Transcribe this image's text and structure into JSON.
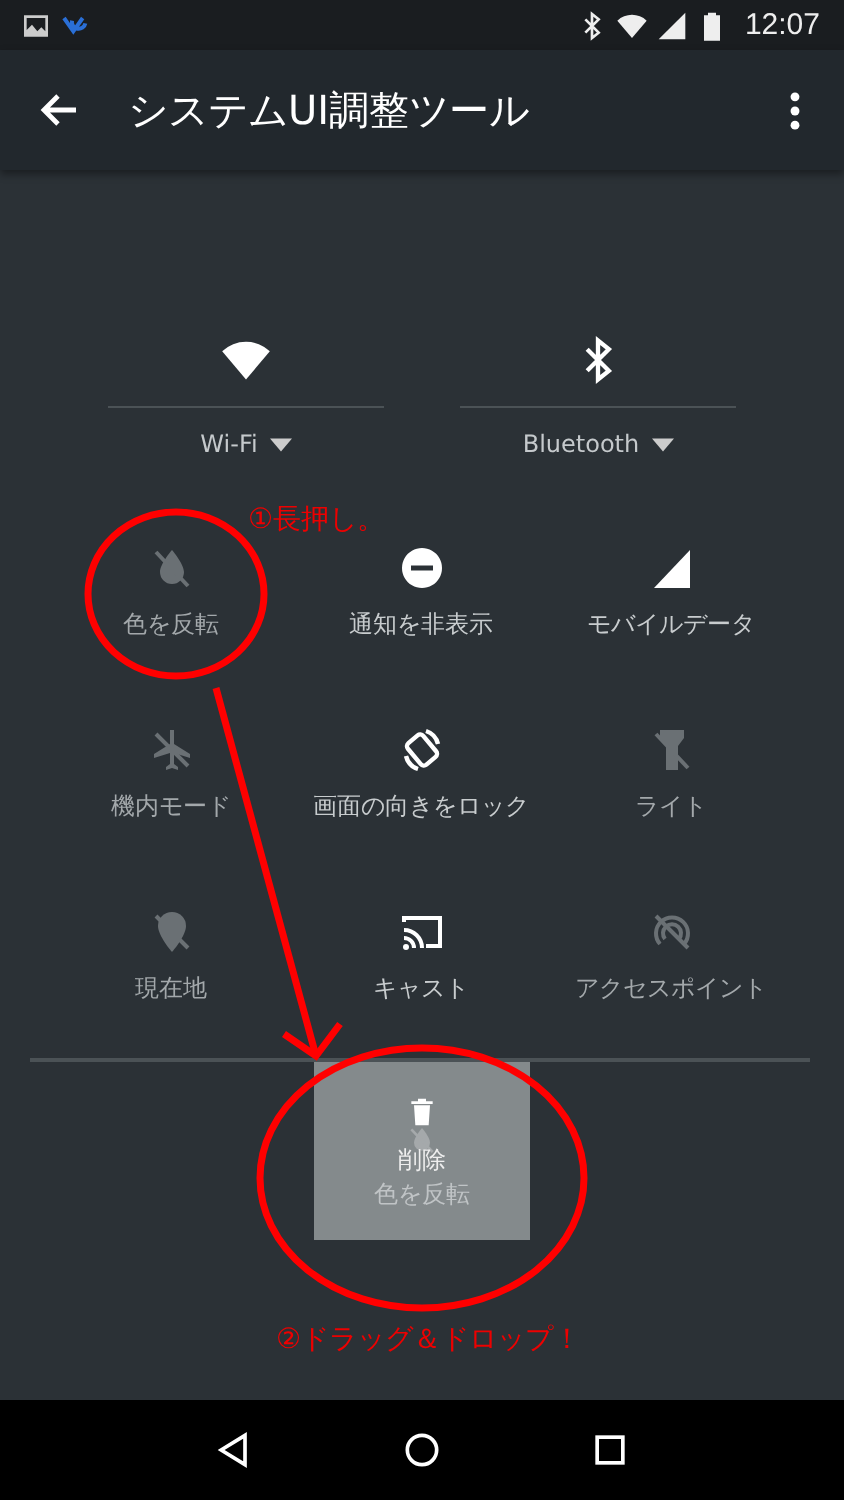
{
  "status_bar": {
    "time": "12:07"
  },
  "app_bar": {
    "title": "システムUI調整ツール"
  },
  "big_tiles": [
    {
      "kind": "wifi",
      "label": "Wi-Fi"
    },
    {
      "kind": "bluetooth",
      "label": "Bluetooth"
    }
  ],
  "tiles": [
    {
      "kind": "invert",
      "label": "色を反転",
      "on": false
    },
    {
      "kind": "dnd",
      "label": "通知を非表示",
      "on": true
    },
    {
      "kind": "cellular",
      "label": "モバイルデータ",
      "on": true
    },
    {
      "kind": "airplane",
      "label": "機内モード",
      "on": false
    },
    {
      "kind": "rotation",
      "label": "画面の向きをロック",
      "on": true
    },
    {
      "kind": "flashlight",
      "label": "ライト",
      "on": false
    },
    {
      "kind": "location",
      "label": "現在地",
      "on": false
    },
    {
      "kind": "cast",
      "label": "キャスト",
      "on": true
    },
    {
      "kind": "hotspot",
      "label": "アクセスポイント",
      "on": false
    }
  ],
  "drag_tile": {
    "action": "削除",
    "label": "色を反転"
  },
  "annotations": [
    "①長押し。",
    "②ドラッグ＆ドロップ！"
  ]
}
